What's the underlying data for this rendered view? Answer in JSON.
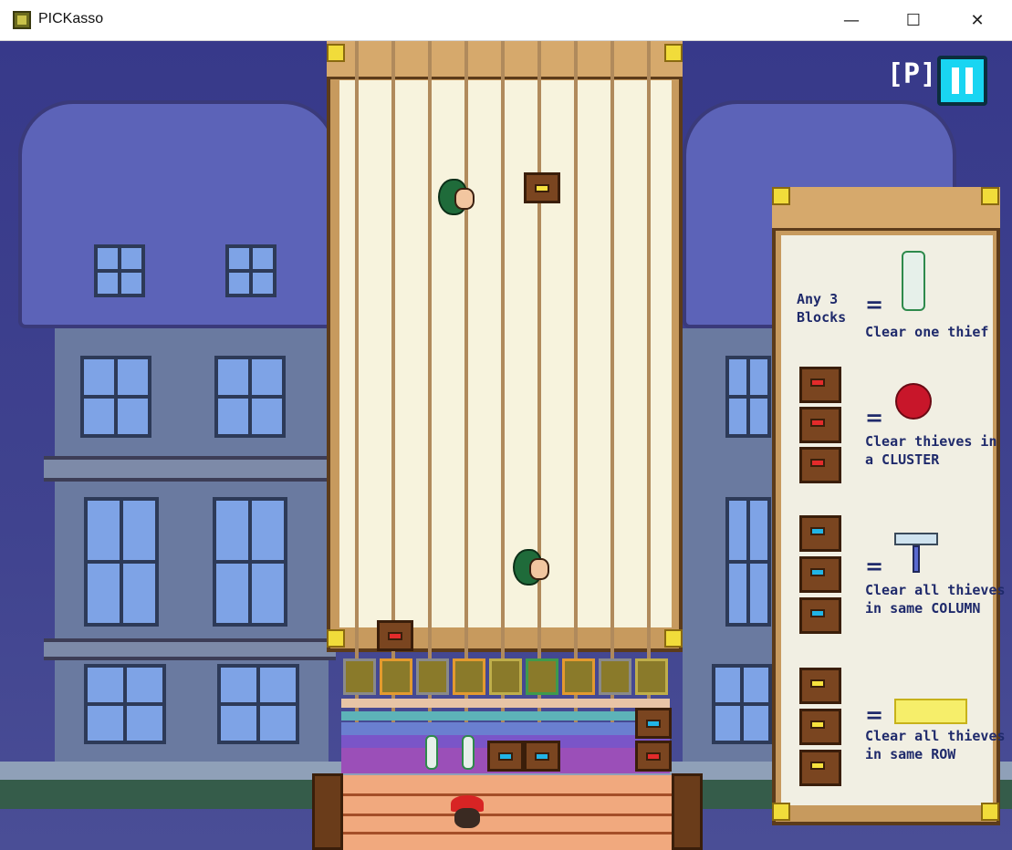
{
  "window": {
    "title": "PICKasso"
  },
  "hud": {
    "p_label": "[P]"
  },
  "legend": {
    "pencil_rule_left": [
      "Any 3",
      "Blocks"
    ],
    "pencil_rule_right": "Clear one thief",
    "red_rule": [
      "Clear thieves in",
      "a CLUSTER"
    ],
    "blue_rule": [
      "Clear all thieves",
      "in same COLUMN"
    ],
    "yellow_rule": [
      "Clear all thieves",
      "in same ROW"
    ],
    "equals": "="
  },
  "colors": {
    "red": "#e32b2b",
    "blue": "#21b4e6",
    "yellow": "#f6e23e",
    "pause": "#19d5f2"
  }
}
